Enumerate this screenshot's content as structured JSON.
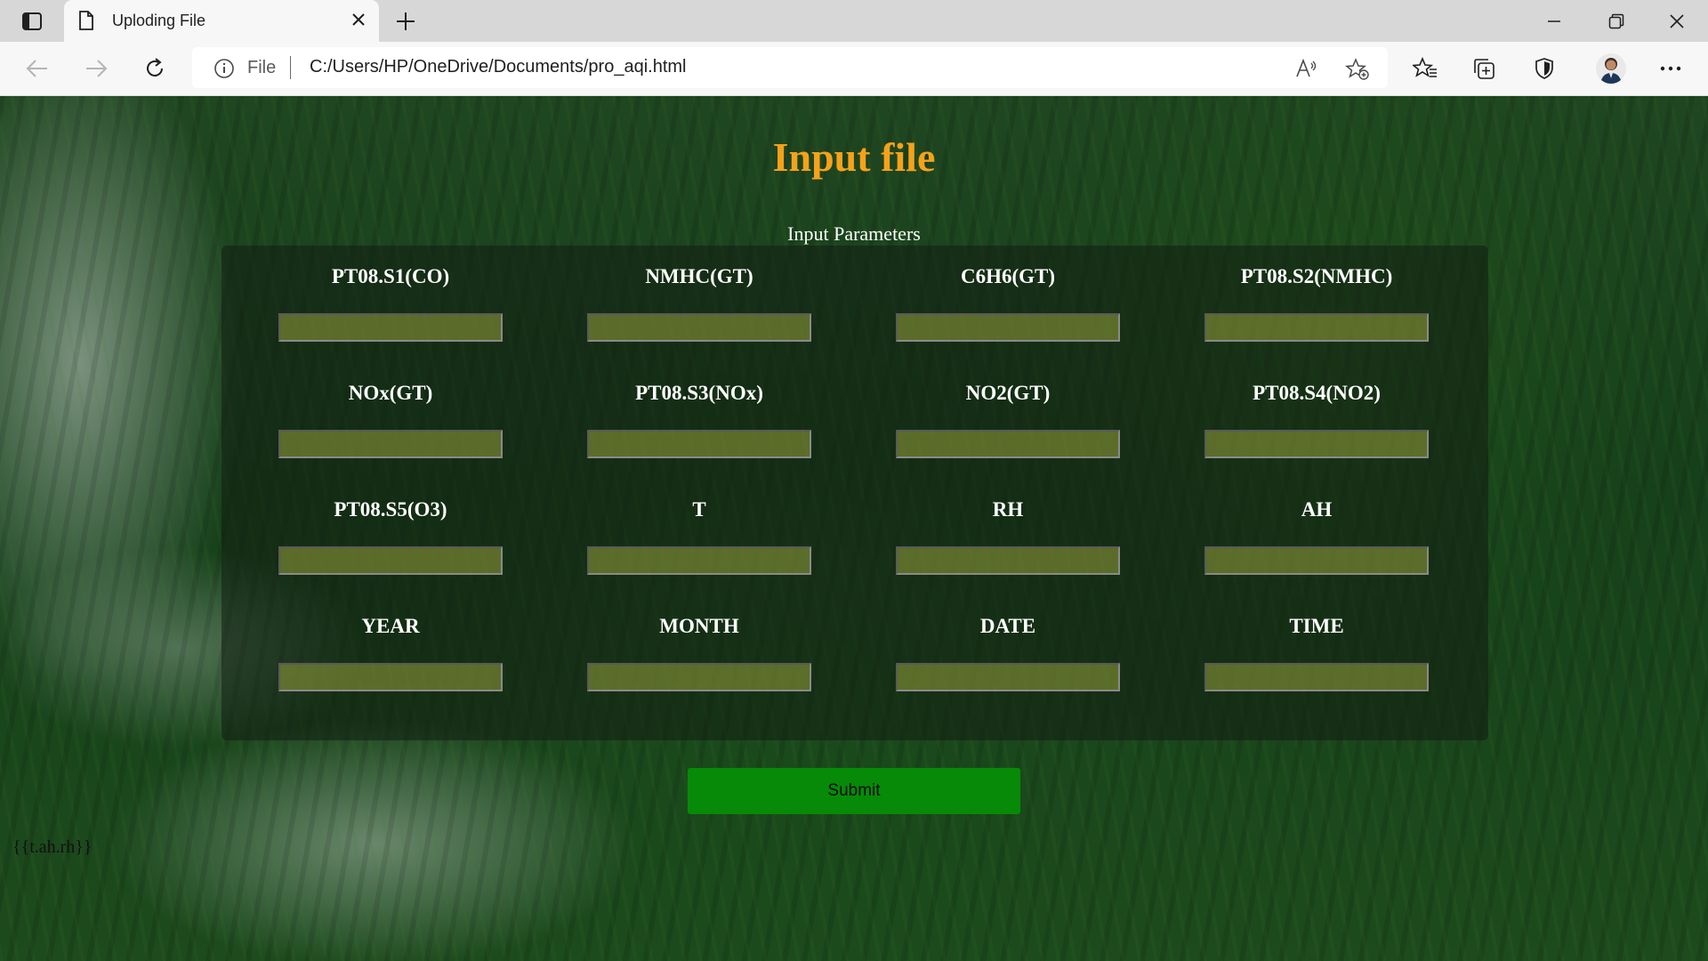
{
  "browser": {
    "tab_title": "Uploding File",
    "address_scheme": "File",
    "address_url": "C:/Users/HP/OneDrive/Documents/pro_aqi.html"
  },
  "page": {
    "heading": "Input file",
    "caption": "Input Parameters",
    "fields": [
      {
        "label": "PT08.S1(CO)",
        "value": ""
      },
      {
        "label": "NMHC(GT)",
        "value": ""
      },
      {
        "label": "C6H6(GT)",
        "value": ""
      },
      {
        "label": "PT08.S2(NMHC)",
        "value": ""
      },
      {
        "label": "NOx(GT)",
        "value": ""
      },
      {
        "label": "PT08.S3(NOx)",
        "value": ""
      },
      {
        "label": "NO2(GT)",
        "value": ""
      },
      {
        "label": "PT08.S4(NO2)",
        "value": ""
      },
      {
        "label": "PT08.S5(O3)",
        "value": ""
      },
      {
        "label": "T",
        "value": ""
      },
      {
        "label": "RH",
        "value": ""
      },
      {
        "label": "AH",
        "value": ""
      },
      {
        "label": "YEAR",
        "value": ""
      },
      {
        "label": "MONTH",
        "value": ""
      },
      {
        "label": "DATE",
        "value": ""
      },
      {
        "label": "TIME",
        "value": ""
      }
    ],
    "submit_label": "Submit",
    "template_text": "{{t.ah.rh}}"
  },
  "colors": {
    "heading": "#f5a21b",
    "submit": "#078a07"
  }
}
